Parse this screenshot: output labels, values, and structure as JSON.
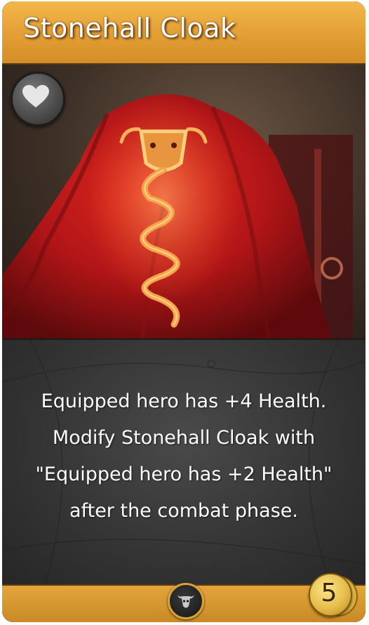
{
  "card": {
    "name": "Stonehall Cloak",
    "ability_text": "Equipped hero has +4 Health. Modify Stonehall Cloak with \"Equipped hero has +2 Health\" after the combat phase.",
    "gold_cost": "5",
    "icons": {
      "stat": "heart-icon",
      "faction": "bull-skull-icon",
      "cost": "gold-coin-icon"
    },
    "colors": {
      "title_bar": "#e6a238",
      "cloak_red": "#c7191c",
      "emblem_gold": "#f2a34a",
      "text_panel": "#333333"
    }
  }
}
